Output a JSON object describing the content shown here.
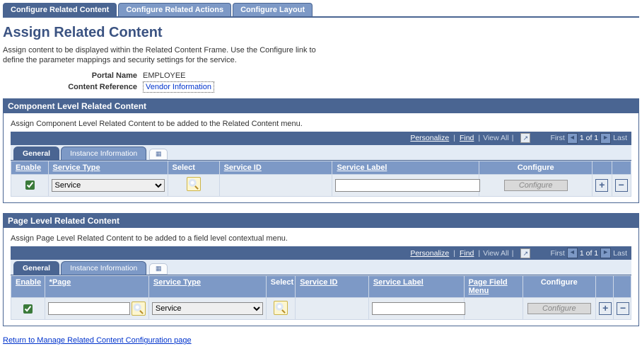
{
  "page_tabs": [
    {
      "label": "Configure Related Content",
      "active": true
    },
    {
      "label": "Configure Related Actions",
      "active": false
    },
    {
      "label": "Configure Layout",
      "active": false
    }
  ],
  "title": "Assign Related Content",
  "instructions": "Assign content to be displayed within the Related Content Frame. Use the Configure link to define the parameter mappings and security settings for the service.",
  "portal_name_label": "Portal Name",
  "portal_name_value": "EMPLOYEE",
  "content_ref_label": "Content Reference",
  "content_ref_value": "Vendor Information",
  "toolbar": {
    "personalize": "Personalize",
    "find": "Find",
    "view_all": "View All",
    "first": "First",
    "paging": "1 of 1",
    "last": "Last"
  },
  "grid_tabs": {
    "general": "General",
    "instance": "Instance Information"
  },
  "comp_section": {
    "header": "Component Level Related Content",
    "instruct": "Assign Component Level Related Content to be added to the Related Content menu.",
    "cols": {
      "c0": "Enable",
      "c1": "Service Type",
      "c2": "Select",
      "c3": "Service ID",
      "c4": "Service Label",
      "c5": "Configure"
    },
    "row": {
      "enable": true,
      "service_type": "Service",
      "service_label": "",
      "configure_btn": "Configure"
    }
  },
  "page_section": {
    "header": "Page Level Related Content",
    "instruct": "Assign Page Level Related Content to be added to a field level contextual menu.",
    "cols": {
      "c0": "Enable",
      "c1": "*Page",
      "c2": "Service Type",
      "c3": "Select",
      "c4": "Service ID",
      "c5": "Service Label",
      "c6": "Page Field Menu",
      "c7": "Configure"
    },
    "row": {
      "enable": true,
      "page": "",
      "service_type": "Service",
      "service_label": "",
      "configure_btn": "Configure"
    }
  },
  "return_link": "Return to Manage Related Content Configuration page"
}
